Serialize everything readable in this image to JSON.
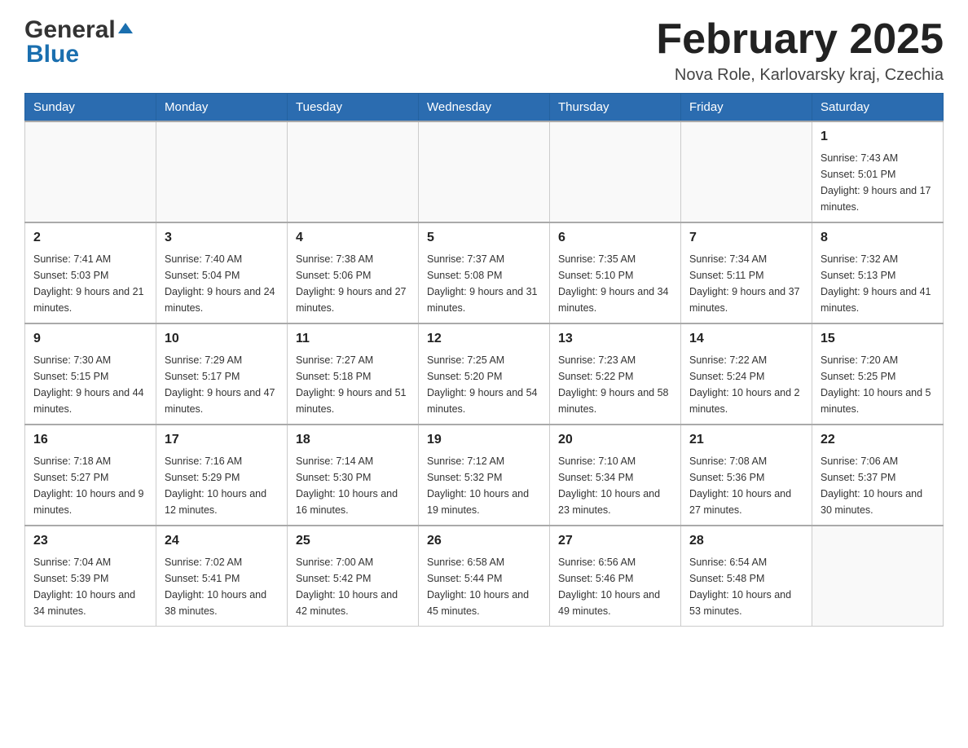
{
  "header": {
    "logo_general": "General",
    "logo_blue": "Blue",
    "month_title": "February 2025",
    "location": "Nova Role, Karlovarsky kraj, Czechia"
  },
  "days_of_week": [
    "Sunday",
    "Monday",
    "Tuesday",
    "Wednesday",
    "Thursday",
    "Friday",
    "Saturday"
  ],
  "weeks": [
    [
      {
        "day": "",
        "sunrise": "",
        "sunset": "",
        "daylight": ""
      },
      {
        "day": "",
        "sunrise": "",
        "sunset": "",
        "daylight": ""
      },
      {
        "day": "",
        "sunrise": "",
        "sunset": "",
        "daylight": ""
      },
      {
        "day": "",
        "sunrise": "",
        "sunset": "",
        "daylight": ""
      },
      {
        "day": "",
        "sunrise": "",
        "sunset": "",
        "daylight": ""
      },
      {
        "day": "",
        "sunrise": "",
        "sunset": "",
        "daylight": ""
      },
      {
        "day": "1",
        "sunrise": "Sunrise: 7:43 AM",
        "sunset": "Sunset: 5:01 PM",
        "daylight": "Daylight: 9 hours and 17 minutes."
      }
    ],
    [
      {
        "day": "2",
        "sunrise": "Sunrise: 7:41 AM",
        "sunset": "Sunset: 5:03 PM",
        "daylight": "Daylight: 9 hours and 21 minutes."
      },
      {
        "day": "3",
        "sunrise": "Sunrise: 7:40 AM",
        "sunset": "Sunset: 5:04 PM",
        "daylight": "Daylight: 9 hours and 24 minutes."
      },
      {
        "day": "4",
        "sunrise": "Sunrise: 7:38 AM",
        "sunset": "Sunset: 5:06 PM",
        "daylight": "Daylight: 9 hours and 27 minutes."
      },
      {
        "day": "5",
        "sunrise": "Sunrise: 7:37 AM",
        "sunset": "Sunset: 5:08 PM",
        "daylight": "Daylight: 9 hours and 31 minutes."
      },
      {
        "day": "6",
        "sunrise": "Sunrise: 7:35 AM",
        "sunset": "Sunset: 5:10 PM",
        "daylight": "Daylight: 9 hours and 34 minutes."
      },
      {
        "day": "7",
        "sunrise": "Sunrise: 7:34 AM",
        "sunset": "Sunset: 5:11 PM",
        "daylight": "Daylight: 9 hours and 37 minutes."
      },
      {
        "day": "8",
        "sunrise": "Sunrise: 7:32 AM",
        "sunset": "Sunset: 5:13 PM",
        "daylight": "Daylight: 9 hours and 41 minutes."
      }
    ],
    [
      {
        "day": "9",
        "sunrise": "Sunrise: 7:30 AM",
        "sunset": "Sunset: 5:15 PM",
        "daylight": "Daylight: 9 hours and 44 minutes."
      },
      {
        "day": "10",
        "sunrise": "Sunrise: 7:29 AM",
        "sunset": "Sunset: 5:17 PM",
        "daylight": "Daylight: 9 hours and 47 minutes."
      },
      {
        "day": "11",
        "sunrise": "Sunrise: 7:27 AM",
        "sunset": "Sunset: 5:18 PM",
        "daylight": "Daylight: 9 hours and 51 minutes."
      },
      {
        "day": "12",
        "sunrise": "Sunrise: 7:25 AM",
        "sunset": "Sunset: 5:20 PM",
        "daylight": "Daylight: 9 hours and 54 minutes."
      },
      {
        "day": "13",
        "sunrise": "Sunrise: 7:23 AM",
        "sunset": "Sunset: 5:22 PM",
        "daylight": "Daylight: 9 hours and 58 minutes."
      },
      {
        "day": "14",
        "sunrise": "Sunrise: 7:22 AM",
        "sunset": "Sunset: 5:24 PM",
        "daylight": "Daylight: 10 hours and 2 minutes."
      },
      {
        "day": "15",
        "sunrise": "Sunrise: 7:20 AM",
        "sunset": "Sunset: 5:25 PM",
        "daylight": "Daylight: 10 hours and 5 minutes."
      }
    ],
    [
      {
        "day": "16",
        "sunrise": "Sunrise: 7:18 AM",
        "sunset": "Sunset: 5:27 PM",
        "daylight": "Daylight: 10 hours and 9 minutes."
      },
      {
        "day": "17",
        "sunrise": "Sunrise: 7:16 AM",
        "sunset": "Sunset: 5:29 PM",
        "daylight": "Daylight: 10 hours and 12 minutes."
      },
      {
        "day": "18",
        "sunrise": "Sunrise: 7:14 AM",
        "sunset": "Sunset: 5:30 PM",
        "daylight": "Daylight: 10 hours and 16 minutes."
      },
      {
        "day": "19",
        "sunrise": "Sunrise: 7:12 AM",
        "sunset": "Sunset: 5:32 PM",
        "daylight": "Daylight: 10 hours and 19 minutes."
      },
      {
        "day": "20",
        "sunrise": "Sunrise: 7:10 AM",
        "sunset": "Sunset: 5:34 PM",
        "daylight": "Daylight: 10 hours and 23 minutes."
      },
      {
        "day": "21",
        "sunrise": "Sunrise: 7:08 AM",
        "sunset": "Sunset: 5:36 PM",
        "daylight": "Daylight: 10 hours and 27 minutes."
      },
      {
        "day": "22",
        "sunrise": "Sunrise: 7:06 AM",
        "sunset": "Sunset: 5:37 PM",
        "daylight": "Daylight: 10 hours and 30 minutes."
      }
    ],
    [
      {
        "day": "23",
        "sunrise": "Sunrise: 7:04 AM",
        "sunset": "Sunset: 5:39 PM",
        "daylight": "Daylight: 10 hours and 34 minutes."
      },
      {
        "day": "24",
        "sunrise": "Sunrise: 7:02 AM",
        "sunset": "Sunset: 5:41 PM",
        "daylight": "Daylight: 10 hours and 38 minutes."
      },
      {
        "day": "25",
        "sunrise": "Sunrise: 7:00 AM",
        "sunset": "Sunset: 5:42 PM",
        "daylight": "Daylight: 10 hours and 42 minutes."
      },
      {
        "day": "26",
        "sunrise": "Sunrise: 6:58 AM",
        "sunset": "Sunset: 5:44 PM",
        "daylight": "Daylight: 10 hours and 45 minutes."
      },
      {
        "day": "27",
        "sunrise": "Sunrise: 6:56 AM",
        "sunset": "Sunset: 5:46 PM",
        "daylight": "Daylight: 10 hours and 49 minutes."
      },
      {
        "day": "28",
        "sunrise": "Sunrise: 6:54 AM",
        "sunset": "Sunset: 5:48 PM",
        "daylight": "Daylight: 10 hours and 53 minutes."
      },
      {
        "day": "",
        "sunrise": "",
        "sunset": "",
        "daylight": ""
      }
    ]
  ]
}
